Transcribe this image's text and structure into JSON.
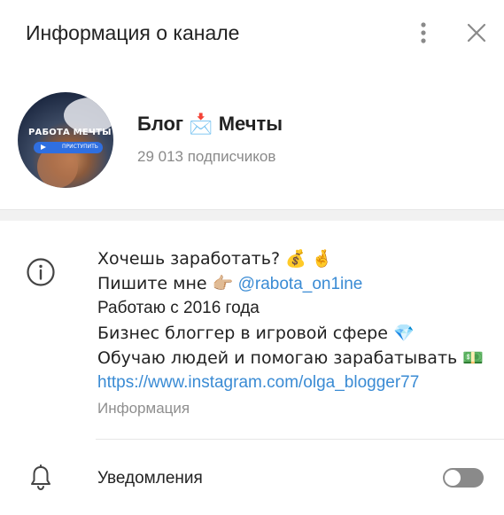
{
  "header": {
    "title": "Информация о канале",
    "more_icon": "more-vertical-icon",
    "close_icon": "close-icon"
  },
  "profile": {
    "avatar_text": "РАБОТА МЕЧТЫ",
    "avatar_button": "ПРИСТУПИТЬ",
    "name": "Блог 📩 Мечты",
    "subscribers": "29 013 подписчиков"
  },
  "info": {
    "icon": "info-icon",
    "lines": [
      "Хочешь заработать? 💰 🤞",
      "Пишите мне 👉🏼",
      "Работаю с 2016 года",
      "Бизнес блоггер в игровой сфере 💎",
      "Обучаю людей и помогаю зарабатывать 💵"
    ],
    "mention": "@rabota_on1ine",
    "link": "https://www.instagram.com/olga_blogger77",
    "label": "Информация"
  },
  "notifications": {
    "icon": "bell-icon",
    "label": "Уведомления",
    "enabled": false
  },
  "colors": {
    "link": "#3a8bd4",
    "secondary_text": "#8a8a8a",
    "toggle_off": "#8a8a8a"
  }
}
